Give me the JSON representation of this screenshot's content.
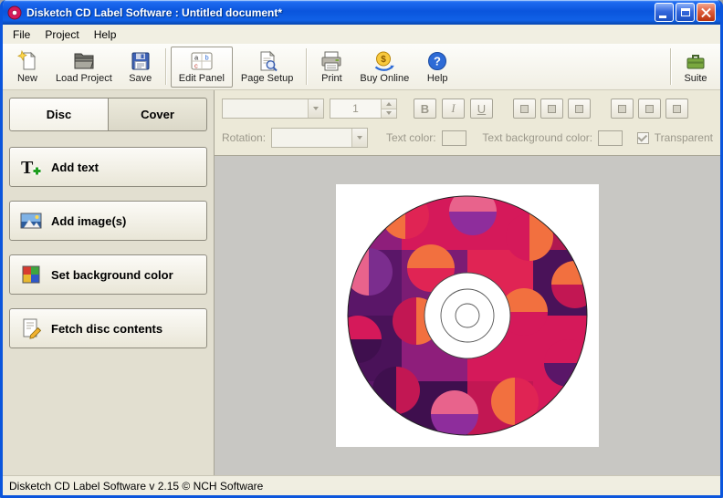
{
  "window": {
    "title": "Disketch CD Label Software : Untitled document*"
  },
  "menu": {
    "items": [
      {
        "label": "File"
      },
      {
        "label": "Project"
      },
      {
        "label": "Help"
      }
    ]
  },
  "toolbar": {
    "buttons": [
      {
        "label": "New"
      },
      {
        "label": "Load Project"
      },
      {
        "label": "Save"
      },
      {
        "label": "Edit Panel",
        "selected": true
      },
      {
        "label": "Page Setup"
      },
      {
        "label": "Print"
      },
      {
        "label": "Buy Online"
      },
      {
        "label": "Help"
      },
      {
        "label": "Suite"
      }
    ]
  },
  "sidebar": {
    "tabs": [
      {
        "label": "Disc",
        "active": true
      },
      {
        "label": "Cover",
        "active": false
      }
    ],
    "actions": [
      {
        "label": "Add text"
      },
      {
        "label": "Add image(s)"
      },
      {
        "label": "Set background color"
      },
      {
        "label": "Fetch disc contents"
      }
    ]
  },
  "format": {
    "font_family_value": "",
    "font_size_value": "1",
    "bold_label": "B",
    "italic_label": "I",
    "underline_label": "U",
    "rotation_label": "Rotation:",
    "rotation_value": "",
    "text_color_label": "Text color:",
    "text_color_swatch": "#ECE9D8",
    "text_background_color_label": "Text background color:",
    "text_background_swatch": "#ECE9D8",
    "transparent_label": "Transparent",
    "transparent_checked": true
  },
  "statusbar": {
    "text": "Disketch CD Label Software v 2.15 © NCH Software"
  },
  "icons": [
    "app-icon",
    "minimize-icon",
    "maximize-icon",
    "close-icon",
    "new-document-icon",
    "load-project-icon",
    "save-icon",
    "edit-panel-icon",
    "page-setup-icon",
    "print-icon",
    "buy-online-icon",
    "help-icon",
    "suite-icon",
    "add-text-icon",
    "add-image-icon",
    "background-color-icon",
    "fetch-contents-icon"
  ],
  "colors": {
    "titlebar_blue": "#0b55dc",
    "chrome_beige": "#ECE9D8",
    "disc_purple": "#5A1668",
    "disc_crimson": "#D5195A",
    "disc_orange": "#F2703F",
    "disc_pink": "#E8638C"
  }
}
